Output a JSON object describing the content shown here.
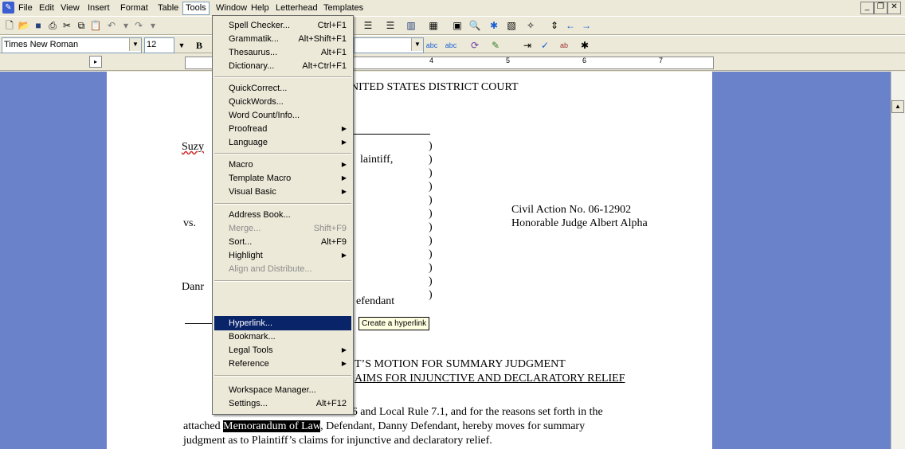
{
  "menubar": [
    "File",
    "Edit",
    "View",
    "Insert",
    "Format",
    "Table",
    "Tools",
    "Window",
    "Help",
    "Letterhead",
    "Templates"
  ],
  "toolbar": {
    "font_name": "Times New Roman",
    "font_size": "12",
    "bold": "B"
  },
  "ruler": [
    "4",
    "5",
    "6",
    "7"
  ],
  "tools_menu": [
    {
      "label": "Spell Checker...",
      "shortcut": "Ctrl+F1"
    },
    {
      "label": "Grammatik...",
      "shortcut": "Alt+Shift+F1"
    },
    {
      "label": "Thesaurus...",
      "shortcut": "Alt+F1"
    },
    {
      "label": "Dictionary...",
      "shortcut": "Alt+Ctrl+F1"
    },
    {
      "label": "QuickCorrect..."
    },
    {
      "label": "QuickWords..."
    },
    {
      "label": "Word Count/Info..."
    },
    {
      "label": "Proofread"
    },
    {
      "label": "Language"
    },
    {
      "label": "Macro"
    },
    {
      "label": "Template Macro"
    },
    {
      "label": "Visual Basic"
    },
    {
      "label": "Address Book..."
    },
    {
      "label": "Merge...",
      "shortcut": "Shift+F9"
    },
    {
      "label": "Sort...",
      "shortcut": "Alt+F9"
    },
    {
      "label": "Highlight"
    },
    {
      "label": "Align and Distribute..."
    },
    {
      "label": "Hyperlink..."
    },
    {
      "label": "Bookmark..."
    },
    {
      "label": "Legal Tools"
    },
    {
      "label": "Reference"
    },
    {
      "label": "Workspace Manager..."
    },
    {
      "label": "Settings...",
      "shortcut": "Alt+F12"
    }
  ],
  "tooltip": "Create a hyperlink",
  "document": {
    "court_fragment": "NITED STATES DISTRICT COURT",
    "plaintiff_name_fragment": "Suzy",
    "plaintiff_label_fragment": "laintiff,",
    "versus": "vs.",
    "civil_action": "Civil Action No. 06-12902",
    "judge": "Honorable Judge Albert Alpha",
    "defendant_name_fragment": "Danr",
    "defendant_label_fragment": "efendant",
    "paren": ")",
    "motion_title_1": "T’S MOTION FOR SUMMARY JUDGMENT",
    "motion_title_2": "AIMS FOR INJUNCTIVE AND DECLARATORY RELIEF",
    "body_line_1": "Pursuant to Fed. R. Civ. P. 56 and Local Rule 7.1, and for the reasons set forth in the",
    "body_attached": "attached",
    "body_selected": "Memorandum of Law",
    "body_line_2_rest": ", Defendant, Danny Defendant, hereby moves for summary",
    "body_line_3": "judgment as to Plaintiff’s claims for injunctive and declaratory relief."
  }
}
